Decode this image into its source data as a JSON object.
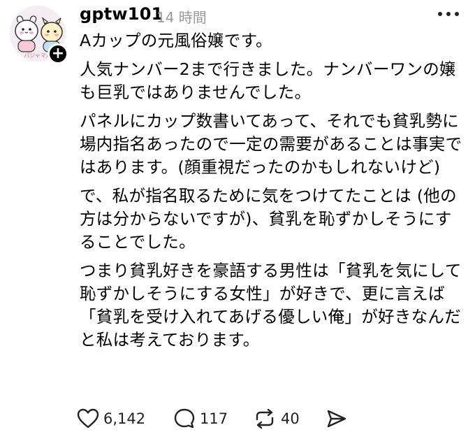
{
  "post": {
    "username": "gptw101",
    "timestamp": "14 時間",
    "paragraphs": [
      "Aカップの元風俗嬢です。",
      "人気ナンバー2まで行きました。ナンバーワンの嬢も巨乳ではありませんでした。",
      "パネルにカップ数書いてあって、それでも貧乳勢に場内指名あったので一定の需要があることは事実ではあります。(顔重視だったのかもしれないけど)",
      "で、私が指名取るために気をつけてたことは (他の方は分からないですが)、貧乳を恥ずかしそうにすることでした。",
      "つまり貧乳好きを豪語する男性は「貧乳を気にして恥ずかしそうにする女性」が好きで、更に言えば「貧乳を受け入れてあげる優しい俺」が好きなんだと私は考えております。"
    ],
    "avatar_text": "パジャマパ"
  },
  "actions": {
    "like_count": "6,142",
    "reply_count": "117",
    "repost_count": "40"
  },
  "icons": {
    "like": "heart-icon",
    "reply": "speech-bubble-icon",
    "repost": "repost-arrows-icon",
    "share": "send-icon",
    "more": "more-dots-icon"
  }
}
